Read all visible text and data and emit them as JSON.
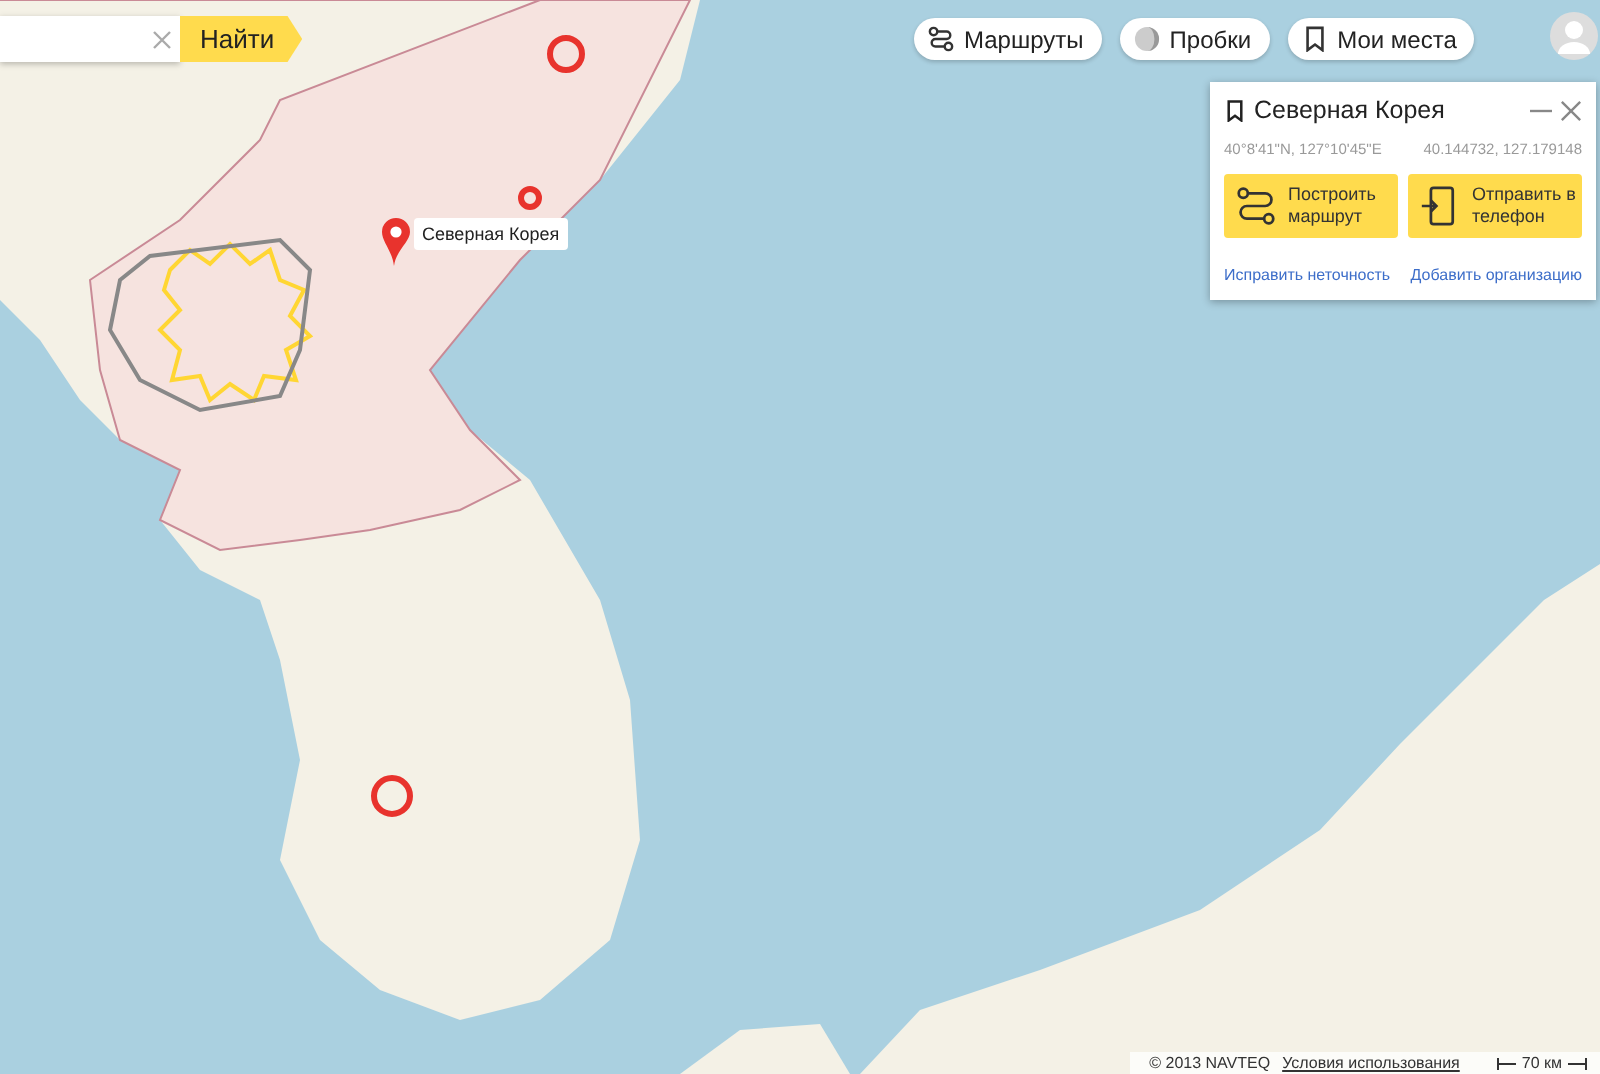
{
  "search": {
    "button": "Найти"
  },
  "toolbar": [
    {
      "kind": "routes",
      "label": "Маршруты"
    },
    {
      "kind": "traffic",
      "label": "Пробки"
    },
    {
      "kind": "places",
      "label": "Мои места"
    }
  ],
  "card": {
    "title": "Северная Корея",
    "coords_dms": "40°8'41\"N, 127°10'45\"E",
    "coords_decimal": "40.144732, 127.179148",
    "actions": [
      {
        "kind": "route",
        "label": "Построить маршрут"
      },
      {
        "kind": "phone",
        "label": "Отправить в телефон"
      }
    ],
    "links": [
      "Исправить неточность",
      "Добавить организацию"
    ]
  },
  "placemark": {
    "label": "Северная Корея"
  },
  "footer": {
    "copyright": "© 2013 NAVTEQ",
    "terms": "Условия использования",
    "scale": "70 км"
  }
}
